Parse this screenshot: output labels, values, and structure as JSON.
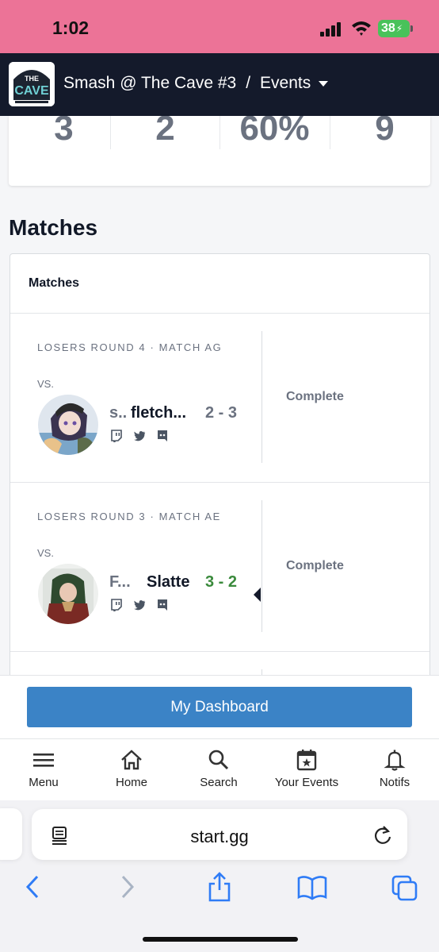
{
  "status_bar": {
    "time": "1:02",
    "battery": "38"
  },
  "header": {
    "logo_text": "THE CAVE",
    "event_name": "Smash @ The Cave #3",
    "separator": "/",
    "section": "Events"
  },
  "stats": [
    "3",
    "2",
    "60%",
    "9"
  ],
  "matches_heading": "Matches",
  "matches_card_title": "Matches",
  "matches": [
    {
      "round": "LOSERS ROUND 4 · MATCH AG",
      "vs": "VS.",
      "prefix": "s..",
      "player": "fletch...",
      "score": "2 - 3",
      "status": "Complete",
      "winner": false
    },
    {
      "round": "LOSERS ROUND 3 · MATCH AE",
      "vs": "VS.",
      "prefix": "F...",
      "player": "Slatte",
      "score": "3 - 2",
      "status": "Complete",
      "winner": true
    }
  ],
  "dashboard_button": "My Dashboard",
  "bottom_nav": [
    {
      "label": "Menu",
      "icon": "menu-icon"
    },
    {
      "label": "Home",
      "icon": "home-icon"
    },
    {
      "label": "Search",
      "icon": "search-icon"
    },
    {
      "label": "Your Events",
      "icon": "calendar-icon"
    },
    {
      "label": "Notifs",
      "icon": "bell-icon"
    }
  ],
  "browser": {
    "url": "start.gg"
  },
  "colors": {
    "status_bar": "#ec7397",
    "header": "#141a2b",
    "accent": "#3b83c6",
    "win": "#3a8a3c",
    "battery": "#49c25a"
  }
}
